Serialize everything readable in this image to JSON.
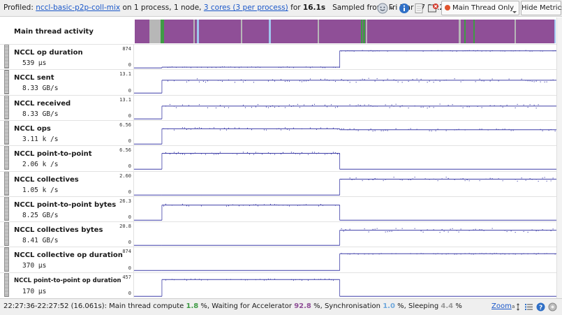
{
  "header": {
    "profiled_prefix": "Profiled:",
    "profile_name": "nccl-basic-p2p-coll-mix",
    "process_text": "on 1 process, 1 node,",
    "cores_link": "3 cores (3 per process)",
    "for_text": "for",
    "duration": "16.1s",
    "sampled_text": "Sampled from: Fri Mar 27 22:27:36 2026",
    "thread_select": "Main Thread Only",
    "hide_metrics_label": "Hide Metrics"
  },
  "activity": {
    "label": "Main thread activity",
    "colors": {
      "waiting": "#8f4f97",
      "compute": "#3f9b45",
      "sync": "#9fc6ee",
      "sleeping": "#b7b7b7"
    },
    "segments": [
      {
        "start": 0.0,
        "end": 0.034,
        "type": "waiting"
      },
      {
        "start": 0.034,
        "end": 0.062,
        "type": "sleeping"
      },
      {
        "start": 0.062,
        "end": 0.07,
        "type": "compute"
      },
      {
        "start": 0.139,
        "end": 0.143,
        "type": "sleeping"
      },
      {
        "start": 0.148,
        "end": 0.152,
        "type": "sync"
      },
      {
        "start": 0.252,
        "end": 0.256,
        "type": "sleeping"
      },
      {
        "start": 0.318,
        "end": 0.323,
        "type": "sync"
      },
      {
        "start": 0.434,
        "end": 0.438,
        "type": "sleeping"
      },
      {
        "start": 0.537,
        "end": 0.54,
        "type": "compute"
      },
      {
        "start": 0.543,
        "end": 0.547,
        "type": "compute"
      },
      {
        "start": 0.549,
        "end": 0.553,
        "type": "sleeping"
      },
      {
        "start": 0.77,
        "end": 0.774,
        "type": "sleeping"
      },
      {
        "start": 0.783,
        "end": 0.786,
        "type": "compute"
      },
      {
        "start": 0.804,
        "end": 0.808,
        "type": "compute"
      },
      {
        "start": 0.902,
        "end": 0.906,
        "type": "sleeping"
      },
      {
        "start": 0.997,
        "end": 1.0,
        "type": "sync"
      }
    ]
  },
  "metrics": [
    {
      "name": "NCCL op duration",
      "value": "539 µs",
      "ymax": "874",
      "ymin": "0",
      "phase1": 0.04,
      "phase2": 0.84,
      "scatter": 0.02
    },
    {
      "name": "NCCL sent",
      "value": "8.33 GB/s",
      "ymax": "13.1",
      "ymin": "0",
      "phase1": 0.63,
      "phase2": 0.63,
      "scatter": 0.1
    },
    {
      "name": "NCCL received",
      "value": "8.33 GB/s",
      "ymax": "13.1",
      "ymin": "0",
      "phase1": 0.63,
      "phase2": 0.63,
      "scatter": 0.1
    },
    {
      "name": "NCCL ops",
      "value": "3.11 k /s",
      "ymax": "6.56",
      "ymin": "0",
      "phase1": 0.75,
      "phase2": 0.7,
      "scatter": 0.06
    },
    {
      "name": "NCCL point-to-point",
      "value": "2.06 k /s",
      "ymax": "6.56",
      "ymin": "0",
      "phase1": 0.78,
      "phase2": 0.0,
      "scatter": 0.06
    },
    {
      "name": "NCCL collectives",
      "value": "1.05 k /s",
      "ymax": "2.60",
      "ymin": "0",
      "phase1": 0.0,
      "phase2": 0.78,
      "scatter": 0.1
    },
    {
      "name": "NCCL point-to-point bytes",
      "value": "8.25 GB/s",
      "ymax": "26.3",
      "ymin": "0",
      "phase1": 0.74,
      "phase2": 0.0,
      "scatter": 0.05
    },
    {
      "name": "NCCL collectives bytes",
      "value": "8.41 GB/s",
      "ymax": "20.8",
      "ymin": "0",
      "phase1": 0.0,
      "phase2": 0.74,
      "scatter": 0.1
    },
    {
      "name": "NCCL collective op duration",
      "value": "370 µs",
      "ymax": "874",
      "ymin": "0",
      "phase1": 0.0,
      "phase2": 0.82,
      "scatter": 0.02
    },
    {
      "name": "NCCL point-to-point op duration",
      "value": "170 µs",
      "ymax": "457",
      "ymin": "0",
      "phase1": 0.82,
      "phase2": 0.0,
      "scatter": 0.03
    }
  ],
  "series_color": "#3f3fa8",
  "phase_split": 0.487,
  "phase_start": 0.066,
  "status": {
    "range": "22:27:36-22:27:52 (16.061s): Main thread compute",
    "compute_pct": "1.8",
    "compute_color": "#3f9b45",
    "waiting_label": "%, Waiting for Accelerator",
    "waiting_pct": "92.8",
    "waiting_color": "#8f4f97",
    "sync_label": "%, Synchronisation",
    "sync_pct": "1.0",
    "sync_color": "#6fa8dc",
    "sleep_label": "%, Sleeping",
    "sleep_pct": "4.4",
    "sleep_color": "#9a9a9a",
    "end": "%",
    "zoom_label": "Zoom"
  }
}
